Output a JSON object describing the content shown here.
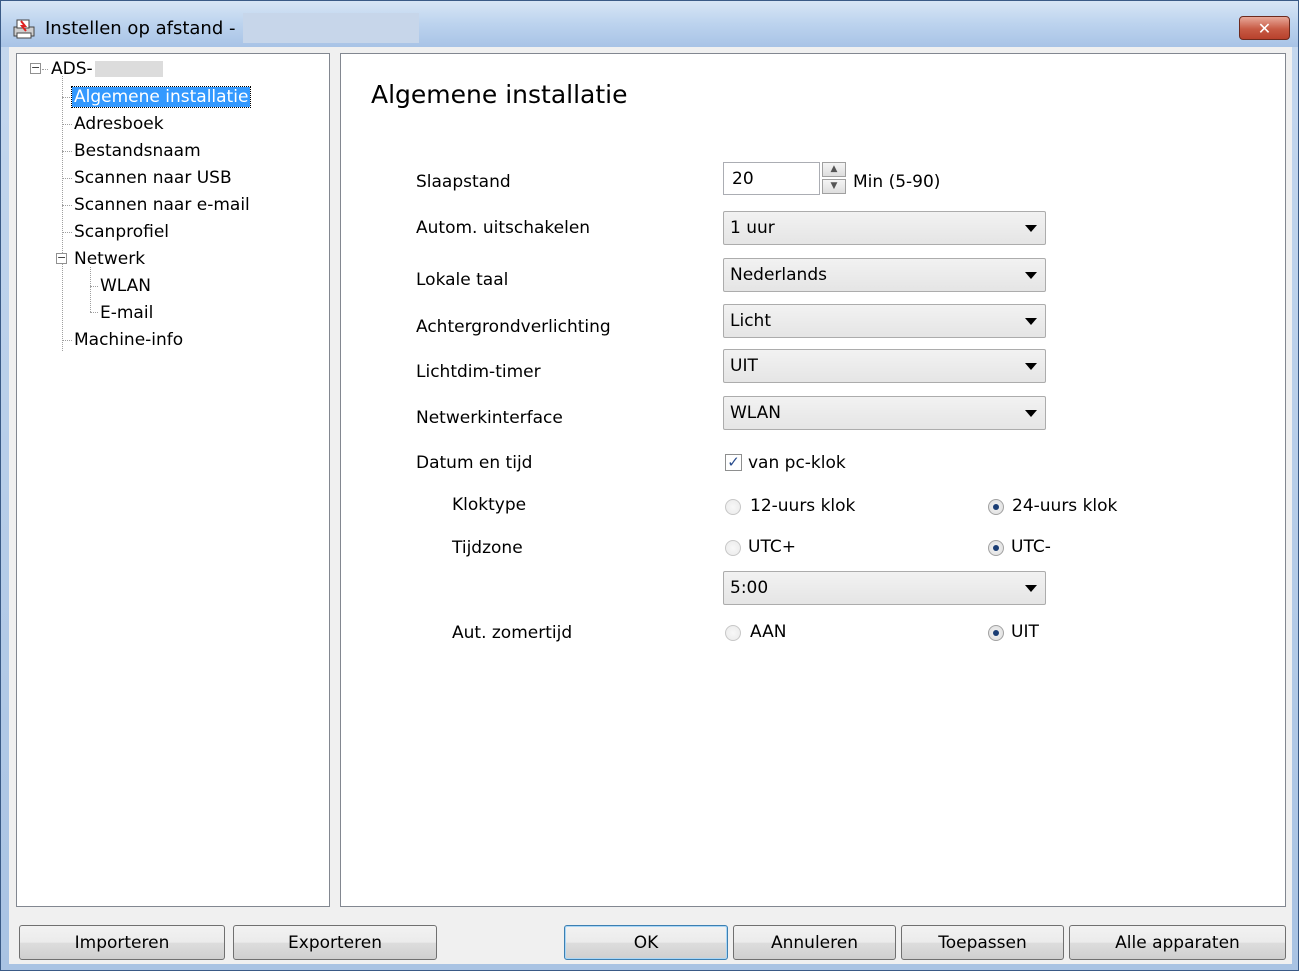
{
  "window": {
    "title": "Instellen op afstand -",
    "close_label": "✕"
  },
  "tree": {
    "root": "ADS-",
    "items": [
      {
        "label": "Algemene installatie"
      },
      {
        "label": "Adresboek"
      },
      {
        "label": "Bestandsnaam"
      },
      {
        "label": "Scannen naar USB"
      },
      {
        "label": "Scannen naar e-mail"
      },
      {
        "label": "Scanprofiel"
      },
      {
        "label": "Netwerk"
      },
      {
        "label": "WLAN"
      },
      {
        "label": "E-mail"
      },
      {
        "label": "Machine-info"
      }
    ]
  },
  "panel": {
    "title": "Algemene installatie",
    "sleep": {
      "label": "Slaapstand",
      "value": "20",
      "unit": "Min (5-90)"
    },
    "auto_off": {
      "label": "Autom. uitschakelen",
      "value": "1 uur"
    },
    "language": {
      "label": "Lokale taal",
      "value": "Nederlands"
    },
    "backlight": {
      "label": "Achtergrondverlichting",
      "value": "Licht"
    },
    "dim_timer": {
      "label": "Lichtdim-timer",
      "value": "UIT"
    },
    "network_interface": {
      "label": "Netwerkinterface",
      "value": "WLAN"
    },
    "datetime": {
      "label": "Datum en tijd",
      "from_pc_label": "van pc-klok",
      "from_pc_checked": true
    },
    "clock_type": {
      "label": "Kloktype",
      "option1": "12-uurs klok",
      "option2": "24-uurs klok",
      "selected": "24-uurs klok"
    },
    "timezone": {
      "label": "Tijdzone",
      "option1": "UTC+",
      "option2": "UTC-",
      "selected": "UTC-",
      "offset": "5:00"
    },
    "dst": {
      "label": "Aut. zomertijd",
      "option1": "AAN",
      "option2": "UIT",
      "selected": "UIT"
    }
  },
  "buttons": {
    "import": "Importeren",
    "export": "Exporteren",
    "ok": "OK",
    "cancel": "Annuleren",
    "apply": "Toepassen",
    "all_devices": "Alle apparaten"
  }
}
